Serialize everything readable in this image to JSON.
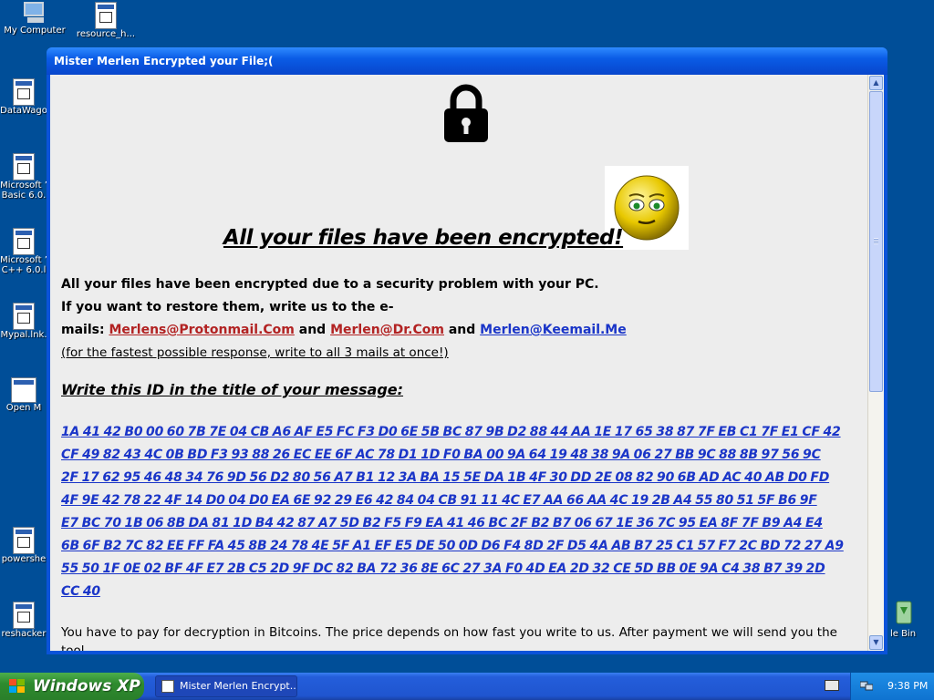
{
  "desktop": {
    "icons": [
      {
        "label": "My Computer"
      },
      {
        "label": "resource_h..."
      },
      {
        "label": "DataWago"
      },
      {
        "label": "Microsoft ’"
      },
      {
        "label": "Basic 6.0."
      },
      {
        "label": "Microsoft ’"
      },
      {
        "label": "C++ 6.0.l"
      },
      {
        "label": "Mypal.lnk."
      },
      {
        "label": "Open M"
      },
      {
        "label": "powershe"
      },
      {
        "label": "reshacker"
      },
      {
        "label": "le Bin"
      }
    ]
  },
  "window": {
    "title": "Mister Merlen Encrypted your File;(",
    "headline": "All your files have been encrypted!",
    "line1": "All your files have been encrypted due to a security problem with your PC.",
    "line2": "If you want to restore them, write us to the e-",
    "line3_prefix": "mails: ",
    "email1": "Merlens@Protonmail.Com",
    "and1": " and ",
    "email2": "Merlen@Dr.Com",
    "and2": " and ",
    "email3": "Merlen@Keemail.Me ",
    "note": "(for the fastest possible response, write to all 3 mails at once!)",
    "id_title": "Write this ID in the title of your message:",
    "id_lines": [
      "1A 41 42 B0 00 60 7B 7E 04 CB A6 AF E5 FC F3 D0 6E 5B BC 87 9B D2 88 44 AA 1E 17 65 38 87 7F EB C1 7F E1 CF 42",
      "CF 49 82 43 4C 0B BD F3 93 88 26 EC EE 6F AC 78 D1 1D F0 BA 00 9A 64 19 48 38 9A 06 27 BB 9C 88 8B 97 56 9C",
      "2F 17 62 95 46 48 34 76 9D 56 D2 80 56 A7 B1 12 3A BA 15 5E DA 1B 4F 30 DD 2E 08 82 90 6B AD AC 40 AB D0 FD",
      "4F 9E 42 78 22 4F 14 D0 04 D0 EA 6E 92 29 E6 42 84 04 CB 91 11 4C E7 AA 66 AA 4C 19 2B A4 55 80 51 5F B6 9F",
      "E7 BC 70 1B 06 8B DA 81 1D B4 42 87 A7 5D B2 F5 F9 EA 41 46 BC 2F B2 B7 06 67 1E 36 7C 95 EA 8F 7F B9 A4 E4",
      "6B 6F B2 7C 82 EE FF FA 45 8B 24 78 4E 5F A1 EF E5 DE 50 0D D6 F4 8D 2F D5 4A AB B7 25 C1 57 F7 2C BD 72 27 A9",
      "55 50 1F 0E 02 BF 4F E7 2B C5 2D 9F DC 82 BA 72 36 8E 6C 27 3A F0 4D EA 2D 32 CE 5D BB 0E 9A C4 38 B7 39 2D",
      "CC 40"
    ],
    "pay_text": "You have to pay for decryption in Bitcoins. The price depends on how fast you write to us. After payment we will send you the tool"
  },
  "taskbar": {
    "start_label": "Windows XP",
    "task_label": "Mister Merlen Encrypt...",
    "clock": "9:38 PM"
  },
  "icons": {
    "lock": "padlock-icon",
    "smiley": "smiley-icon"
  }
}
